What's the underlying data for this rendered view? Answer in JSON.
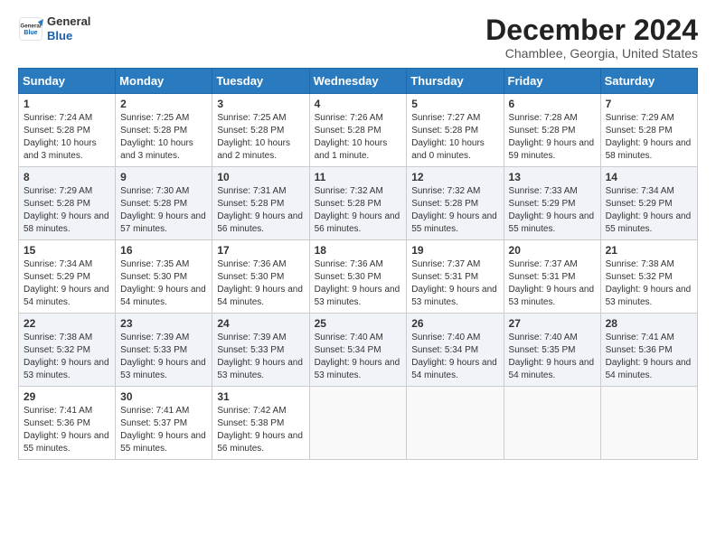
{
  "header": {
    "logo_general": "General",
    "logo_blue": "Blue",
    "month_title": "December 2024",
    "location": "Chamblee, Georgia, United States"
  },
  "days_of_week": [
    "Sunday",
    "Monday",
    "Tuesday",
    "Wednesday",
    "Thursday",
    "Friday",
    "Saturday"
  ],
  "weeks": [
    [
      {
        "day": "1",
        "sunrise": "Sunrise: 7:24 AM",
        "sunset": "Sunset: 5:28 PM",
        "daylight": "Daylight: 10 hours and 3 minutes."
      },
      {
        "day": "2",
        "sunrise": "Sunrise: 7:25 AM",
        "sunset": "Sunset: 5:28 PM",
        "daylight": "Daylight: 10 hours and 3 minutes."
      },
      {
        "day": "3",
        "sunrise": "Sunrise: 7:25 AM",
        "sunset": "Sunset: 5:28 PM",
        "daylight": "Daylight: 10 hours and 2 minutes."
      },
      {
        "day": "4",
        "sunrise": "Sunrise: 7:26 AM",
        "sunset": "Sunset: 5:28 PM",
        "daylight": "Daylight: 10 hours and 1 minute."
      },
      {
        "day": "5",
        "sunrise": "Sunrise: 7:27 AM",
        "sunset": "Sunset: 5:28 PM",
        "daylight": "Daylight: 10 hours and 0 minutes."
      },
      {
        "day": "6",
        "sunrise": "Sunrise: 7:28 AM",
        "sunset": "Sunset: 5:28 PM",
        "daylight": "Daylight: 9 hours and 59 minutes."
      },
      {
        "day": "7",
        "sunrise": "Sunrise: 7:29 AM",
        "sunset": "Sunset: 5:28 PM",
        "daylight": "Daylight: 9 hours and 58 minutes."
      }
    ],
    [
      {
        "day": "8",
        "sunrise": "Sunrise: 7:29 AM",
        "sunset": "Sunset: 5:28 PM",
        "daylight": "Daylight: 9 hours and 58 minutes."
      },
      {
        "day": "9",
        "sunrise": "Sunrise: 7:30 AM",
        "sunset": "Sunset: 5:28 PM",
        "daylight": "Daylight: 9 hours and 57 minutes."
      },
      {
        "day": "10",
        "sunrise": "Sunrise: 7:31 AM",
        "sunset": "Sunset: 5:28 PM",
        "daylight": "Daylight: 9 hours and 56 minutes."
      },
      {
        "day": "11",
        "sunrise": "Sunrise: 7:32 AM",
        "sunset": "Sunset: 5:28 PM",
        "daylight": "Daylight: 9 hours and 56 minutes."
      },
      {
        "day": "12",
        "sunrise": "Sunrise: 7:32 AM",
        "sunset": "Sunset: 5:28 PM",
        "daylight": "Daylight: 9 hours and 55 minutes."
      },
      {
        "day": "13",
        "sunrise": "Sunrise: 7:33 AM",
        "sunset": "Sunset: 5:29 PM",
        "daylight": "Daylight: 9 hours and 55 minutes."
      },
      {
        "day": "14",
        "sunrise": "Sunrise: 7:34 AM",
        "sunset": "Sunset: 5:29 PM",
        "daylight": "Daylight: 9 hours and 55 minutes."
      }
    ],
    [
      {
        "day": "15",
        "sunrise": "Sunrise: 7:34 AM",
        "sunset": "Sunset: 5:29 PM",
        "daylight": "Daylight: 9 hours and 54 minutes."
      },
      {
        "day": "16",
        "sunrise": "Sunrise: 7:35 AM",
        "sunset": "Sunset: 5:30 PM",
        "daylight": "Daylight: 9 hours and 54 minutes."
      },
      {
        "day": "17",
        "sunrise": "Sunrise: 7:36 AM",
        "sunset": "Sunset: 5:30 PM",
        "daylight": "Daylight: 9 hours and 54 minutes."
      },
      {
        "day": "18",
        "sunrise": "Sunrise: 7:36 AM",
        "sunset": "Sunset: 5:30 PM",
        "daylight": "Daylight: 9 hours and 53 minutes."
      },
      {
        "day": "19",
        "sunrise": "Sunrise: 7:37 AM",
        "sunset": "Sunset: 5:31 PM",
        "daylight": "Daylight: 9 hours and 53 minutes."
      },
      {
        "day": "20",
        "sunrise": "Sunrise: 7:37 AM",
        "sunset": "Sunset: 5:31 PM",
        "daylight": "Daylight: 9 hours and 53 minutes."
      },
      {
        "day": "21",
        "sunrise": "Sunrise: 7:38 AM",
        "sunset": "Sunset: 5:32 PM",
        "daylight": "Daylight: 9 hours and 53 minutes."
      }
    ],
    [
      {
        "day": "22",
        "sunrise": "Sunrise: 7:38 AM",
        "sunset": "Sunset: 5:32 PM",
        "daylight": "Daylight: 9 hours and 53 minutes."
      },
      {
        "day": "23",
        "sunrise": "Sunrise: 7:39 AM",
        "sunset": "Sunset: 5:33 PM",
        "daylight": "Daylight: 9 hours and 53 minutes."
      },
      {
        "day": "24",
        "sunrise": "Sunrise: 7:39 AM",
        "sunset": "Sunset: 5:33 PM",
        "daylight": "Daylight: 9 hours and 53 minutes."
      },
      {
        "day": "25",
        "sunrise": "Sunrise: 7:40 AM",
        "sunset": "Sunset: 5:34 PM",
        "daylight": "Daylight: 9 hours and 53 minutes."
      },
      {
        "day": "26",
        "sunrise": "Sunrise: 7:40 AM",
        "sunset": "Sunset: 5:34 PM",
        "daylight": "Daylight: 9 hours and 54 minutes."
      },
      {
        "day": "27",
        "sunrise": "Sunrise: 7:40 AM",
        "sunset": "Sunset: 5:35 PM",
        "daylight": "Daylight: 9 hours and 54 minutes."
      },
      {
        "day": "28",
        "sunrise": "Sunrise: 7:41 AM",
        "sunset": "Sunset: 5:36 PM",
        "daylight": "Daylight: 9 hours and 54 minutes."
      }
    ],
    [
      {
        "day": "29",
        "sunrise": "Sunrise: 7:41 AM",
        "sunset": "Sunset: 5:36 PM",
        "daylight": "Daylight: 9 hours and 55 minutes."
      },
      {
        "day": "30",
        "sunrise": "Sunrise: 7:41 AM",
        "sunset": "Sunset: 5:37 PM",
        "daylight": "Daylight: 9 hours and 55 minutes."
      },
      {
        "day": "31",
        "sunrise": "Sunrise: 7:42 AM",
        "sunset": "Sunset: 5:38 PM",
        "daylight": "Daylight: 9 hours and 56 minutes."
      },
      null,
      null,
      null,
      null
    ]
  ]
}
